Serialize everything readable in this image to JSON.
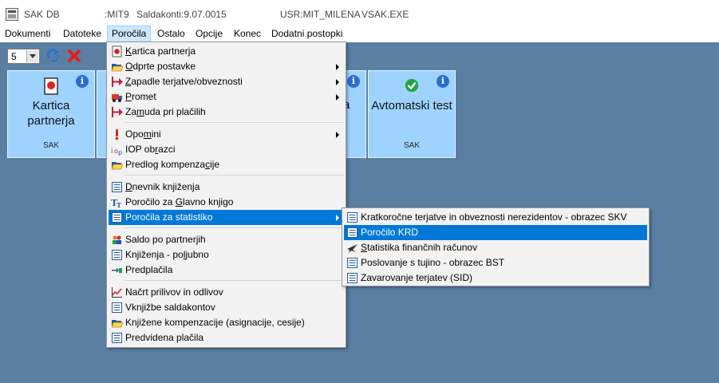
{
  "titlebar": {
    "app": "SAK",
    "db": "DB",
    "user_code": ":MIT9",
    "saldakonti": "Saldakonti:9.07.0015",
    "usr": "USR:MIT_MILENA",
    "exe": "VSAK.EXE"
  },
  "menubar": [
    "Dokumenti",
    "Datoteke",
    "Poročila",
    "Ostalo",
    "Opcije",
    "Konec",
    "Dodatni postopki"
  ],
  "toolbar": {
    "select_value": "5"
  },
  "tiles": [
    {
      "title_line1": "Kartica",
      "title_line2": "partnerja",
      "sub": "SAK"
    },
    {
      "title_line1": "Avtomatski test",
      "title_line2": "",
      "sub": "SAK"
    }
  ],
  "tile_partial_letter": "a",
  "main_menu": [
    {
      "pre": "",
      "acc": "K",
      "post": "artica partnerja",
      "icon": "card-icon",
      "submenu": false
    },
    {
      "pre": "",
      "acc": "O",
      "post": "dprte postavke",
      "icon": "folder-open-icon",
      "submenu": true
    },
    {
      "pre": "",
      "acc": "Z",
      "post": "apadle terjatve/obveznosti",
      "icon": "arrow-right-icon",
      "submenu": true
    },
    {
      "pre": "",
      "acc": "P",
      "post": "romet",
      "icon": "truck-icon",
      "submenu": true
    },
    {
      "pre": "Za",
      "acc": "m",
      "post": "uda pri plačilih",
      "icon": "arrow-right-icon",
      "submenu": false
    },
    {
      "pre": "Opo",
      "acc": "m",
      "post": "ini",
      "icon": "exclamation-icon",
      "submenu": true
    },
    {
      "pre": "IOP ob",
      "acc": "r",
      "post": "azci",
      "icon": "iop-icon",
      "submenu": false
    },
    {
      "pre": "Predlog kompenza",
      "acc": "c",
      "post": "ije",
      "icon": "folder-open-icon",
      "submenu": false
    },
    {
      "pre": "",
      "acc": "D",
      "post": "nevnik knjiženja",
      "icon": "document-list-icon",
      "submenu": false
    },
    {
      "pre": "Poročilo za ",
      "acc": "G",
      "post": "lavno knjigo",
      "icon": "text-tool-icon",
      "submenu": false
    },
    {
      "pre": "Poročila za statistiko",
      "acc": "",
      "post": "",
      "icon": "document-list-icon",
      "submenu": true
    },
    {
      "pre": "Saldo po partnerjih",
      "acc": "",
      "post": "",
      "icon": "people-icon",
      "submenu": false
    },
    {
      "pre": "Knjiženja - po",
      "acc": "l",
      "post": "jubno",
      "icon": "document-list-icon",
      "submenu": false
    },
    {
      "pre": "Predplačila",
      "acc": "",
      "post": "",
      "icon": "transfer-icon",
      "submenu": false
    },
    {
      "pre": "Načrt prilivov in odlivov",
      "acc": "",
      "post": "",
      "icon": "line-chart-icon",
      "submenu": false
    },
    {
      "pre": "Vknjižbe saldakontov",
      "acc": "",
      "post": "",
      "icon": "document-list-icon",
      "submenu": false
    },
    {
      "pre": "Knjižene kompenzacije (asignacije, cesije)",
      "acc": "",
      "post": "",
      "icon": "folder-open-icon",
      "submenu": false
    },
    {
      "pre": "Predvidena plačila",
      "acc": "",
      "post": "",
      "icon": "document-list-icon",
      "submenu": false
    }
  ],
  "sub_menu": [
    {
      "pre": "Kratkoročne terjatve in obveznosti nerezidentov - obrazec SKV",
      "acc": "",
      "post": "",
      "icon": "document-list-icon"
    },
    {
      "pre": "Poročilo KRD",
      "acc": "",
      "post": "",
      "icon": "document-list-icon"
    },
    {
      "pre": "",
      "acc": "S",
      "post": "tatistika finančnih računov",
      "icon": "plane-icon"
    },
    {
      "pre": "Poslovanje s tujino - obrazec BST",
      "acc": "",
      "post": "",
      "icon": "document-list-icon"
    },
    {
      "pre": "Zavarovanje terjatev (SID)",
      "acc": "",
      "post": "",
      "icon": "document-list-icon"
    }
  ]
}
